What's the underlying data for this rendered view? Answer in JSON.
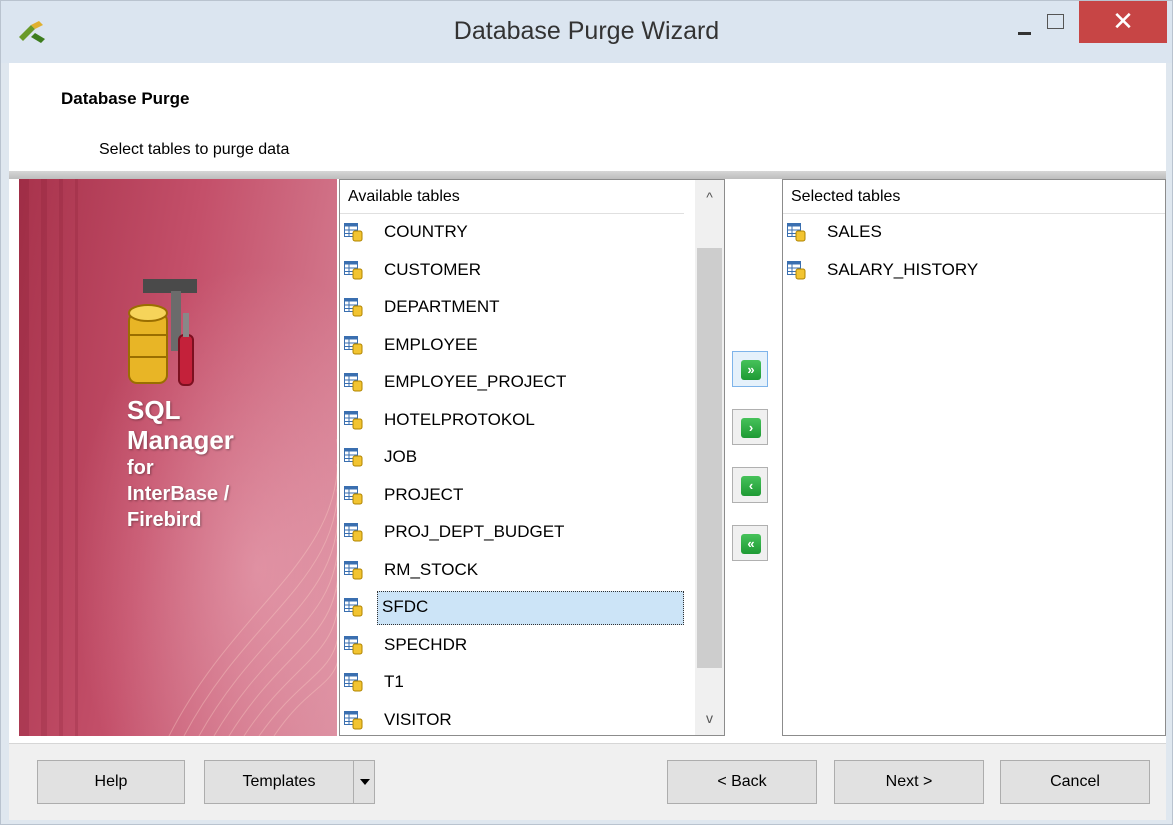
{
  "window": {
    "title": "Database Purge Wizard",
    "close_glyph": "✕"
  },
  "header": {
    "title": "Database Purge",
    "subtitle": "Select tables to purge data"
  },
  "banner": {
    "line1": "SQL",
    "line2": "Manager",
    "line3": "for",
    "line4": "InterBase /",
    "line5": "Firebird"
  },
  "available": {
    "header": "Available tables",
    "items": [
      "COUNTRY",
      "CUSTOMER",
      "DEPARTMENT",
      "EMPLOYEE",
      "EMPLOYEE_PROJECT",
      "HOTELPROTOKOL",
      "JOB",
      "PROJECT",
      "PROJ_DEPT_BUDGET",
      "RM_STOCK",
      "SFDC",
      "SPECHDR",
      "T1",
      "VISITOR"
    ],
    "selected_item": "SFDC",
    "scroll_up_glyph": "^",
    "scroll_down_glyph": "v"
  },
  "selected": {
    "header": "Selected tables",
    "items": [
      "SALES",
      "SALARY_HISTORY"
    ]
  },
  "move_buttons": {
    "add_all": "»",
    "add": "›",
    "remove": "‹",
    "remove_all": "«"
  },
  "footer": {
    "help": "Help",
    "templates": "Templates",
    "back": "< Back",
    "next": "Next >",
    "cancel": "Cancel"
  },
  "colors": {
    "accent_selection": "#cce4f7",
    "close_button": "#c74545",
    "banner": "#b8435b",
    "move_button_icon": "#2aa840"
  },
  "icons": {
    "table": "table-icon",
    "app": "app-icon"
  }
}
